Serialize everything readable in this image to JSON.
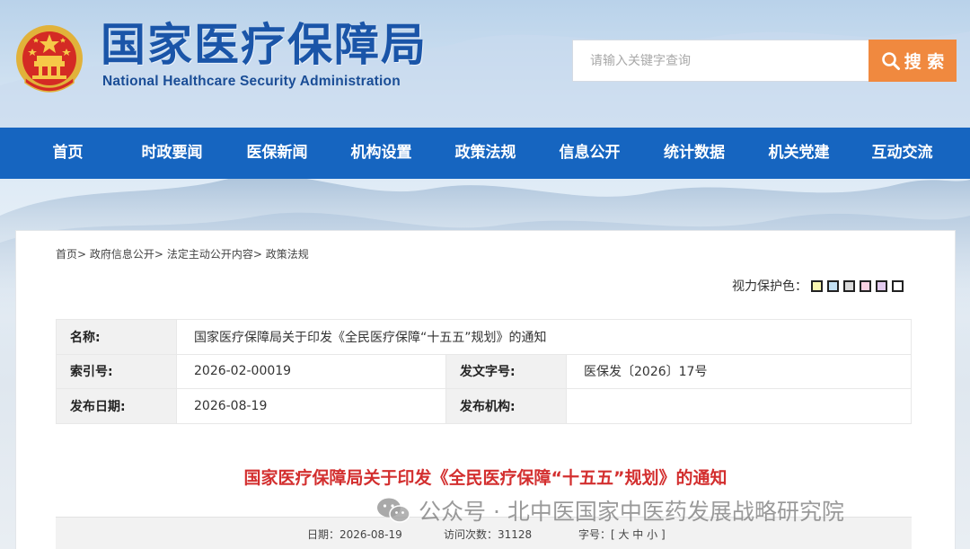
{
  "header": {
    "title": "国家医疗保障局",
    "subtitle": "National Healthcare Security Administration",
    "search": {
      "placeholder": "请输入关键字查询",
      "button_label": "搜 索"
    }
  },
  "nav": {
    "items": [
      {
        "label": "首页"
      },
      {
        "label": "时政要闻"
      },
      {
        "label": "医保新闻"
      },
      {
        "label": "机构设置"
      },
      {
        "label": "政策法规"
      },
      {
        "label": "信息公开"
      },
      {
        "label": "统计数据"
      },
      {
        "label": "机关党建"
      },
      {
        "label": "互动交流"
      }
    ]
  },
  "breadcrumb": {
    "items": [
      "首页",
      "政府信息公开",
      "法定主动公开内容",
      "政策法规"
    ],
    "separator": ">"
  },
  "vision": {
    "label": "视力保护色：",
    "swatches": [
      "#faf6b0",
      "#c4e1f4",
      "#d9d9d9",
      "#f9d2e2",
      "#e3cbef",
      "#ffffff"
    ]
  },
  "meta": {
    "name_label": "名称:",
    "name_value": "国家医疗保障局关于印发《全民医疗保障“十五五”规划》的通知",
    "index_label": "索引号:",
    "index_value": "2026-02-00019",
    "docno_label": "发文字号:",
    "docno_value": "医保发〔2026〕17号",
    "date_label": "发布日期:",
    "date_value": "2026-08-19",
    "org_label": "发布机构:",
    "org_value": ""
  },
  "document": {
    "title": "国家医疗保障局关于印发《全民医疗保障“十五五”规划》的通知"
  },
  "watermark": {
    "text": "公众号 · 北中医国家中医药发展战略研究院"
  },
  "info": {
    "date": "日期：2026-08-19",
    "visits": "访问次数：31128",
    "fontsize": "字号：[ 大 中 小 ]"
  },
  "colors": {
    "nav_bg": "#1665c0",
    "title_blue": "#1a55a8",
    "search_button": "#f0893f",
    "doc_title_red": "#d32f2f"
  }
}
